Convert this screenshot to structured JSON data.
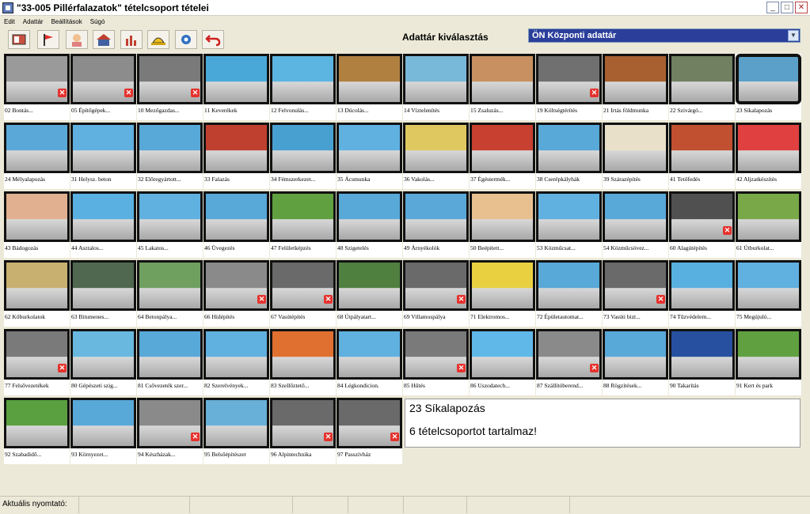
{
  "window": {
    "title": "\"33-005 Pillérfalazatok\" tételcsoport tételei",
    "min": "_",
    "max": "□",
    "close": "✕"
  },
  "menu": [
    "Edit",
    "Adattár",
    "Beállítások",
    "Súgó"
  ],
  "toolbar": {
    "buttons": [
      "book-icon",
      "flag-icon",
      "avatar-icon",
      "building-icon",
      "chart-icon",
      "helmet-icon",
      "gear-icon",
      "undo-arrow-icon"
    ]
  },
  "header": {
    "title": "Adattár kiválasztás",
    "selector_value": "ÖN Központi adattár",
    "arrow": "▼"
  },
  "tiles": [
    {
      "label": "02 Bontás...",
      "color": "#9a9a9a",
      "x": true
    },
    {
      "label": "05 Építőgépek...",
      "color": "#8c8c8c",
      "x": true
    },
    {
      "label": "10 Mezőgazdas...",
      "color": "#7a7a7a",
      "x": true
    },
    {
      "label": "11 Keverékek",
      "color": "#4aa8d8",
      "x": false
    },
    {
      "label": "12 Felvonulás...",
      "color": "#5cb4e0",
      "x": false
    },
    {
      "label": "13 Dúcolás...",
      "color": "#b08040",
      "x": false
    },
    {
      "label": "14 Víztelenítés",
      "color": "#78b8d8",
      "x": false
    },
    {
      "label": "15 Zsaluzás...",
      "color": "#c89060",
      "x": false
    },
    {
      "label": "19 Költségtérítés",
      "color": "#707070",
      "x": true
    },
    {
      "label": "21 Irtás földmunka",
      "color": "#a86030",
      "x": false
    },
    {
      "label": "22 Szivárgó...",
      "color": "#708060",
      "x": false
    },
    {
      "label": "23 Síkalapozás",
      "color": "#5aa0c8",
      "x": false
    },
    {
      "label": "24 Mélyalapozás",
      "color": "#5aa8d8",
      "x": false
    },
    {
      "label": "31 Helysz. beton",
      "color": "#60b0e0",
      "x": false
    },
    {
      "label": "32 Előregyártott...",
      "color": "#58a8d8",
      "x": false
    },
    {
      "label": "33 Falazás",
      "color": "#c04030",
      "x": false
    },
    {
      "label": "34 Fémszerkezet...",
      "color": "#48a0d0",
      "x": false
    },
    {
      "label": "35 Ácsmunka",
      "color": "#60b0e0",
      "x": false
    },
    {
      "label": "36 Vakolás...",
      "color": "#e0c860",
      "x": false
    },
    {
      "label": "37 Égéstermék...",
      "color": "#c84030",
      "x": false
    },
    {
      "label": "38 Cserépkályhák",
      "color": "#58a8d8",
      "x": false
    },
    {
      "label": "39 Szárazépítés",
      "color": "#e8e0c8",
      "x": false
    },
    {
      "label": "41 Tetőfedés",
      "color": "#c05030",
      "x": false
    },
    {
      "label": "42 Aljzatkészítés",
      "color": "#e04040",
      "x": false
    },
    {
      "label": "43 Bádogozás",
      "color": "#e0b090",
      "x": false
    },
    {
      "label": "44 Asztalos...",
      "color": "#5ab0e0",
      "x": false
    },
    {
      "label": "45 Lakatos...",
      "color": "#60b0e0",
      "x": false
    },
    {
      "label": "46 Üvegezés",
      "color": "#58a8d8",
      "x": false
    },
    {
      "label": "47 Felületképzés",
      "color": "#60a040",
      "x": false
    },
    {
      "label": "48 Szigetelés",
      "color": "#58a8d8",
      "x": false
    },
    {
      "label": "49 Árnyékolók",
      "color": "#5aa8d8",
      "x": false
    },
    {
      "label": "50 Beépített...",
      "color": "#e8c090",
      "x": false
    },
    {
      "label": "53 Közműcsat...",
      "color": "#60b0e0",
      "x": false
    },
    {
      "label": "54 Közműcsövez...",
      "color": "#58a8d8",
      "x": false
    },
    {
      "label": "60 Alagútépítés",
      "color": "#505050",
      "x": true
    },
    {
      "label": "61 Útburkolat...",
      "color": "#78a848",
      "x": false
    },
    {
      "label": "62 Kőburkolatok",
      "color": "#c8b070",
      "x": false
    },
    {
      "label": "63 Bitumenes...",
      "color": "#506850",
      "x": false
    },
    {
      "label": "64 Betonpálya...",
      "color": "#70a060",
      "x": false
    },
    {
      "label": "66 Hídépítés",
      "color": "#8a8a8a",
      "x": true
    },
    {
      "label": "67 Vasútépítés",
      "color": "#6a6a6a",
      "x": true
    },
    {
      "label": "68 Útpályatart...",
      "color": "#508040",
      "x": false
    },
    {
      "label": "69 Villamospálya",
      "color": "#6a6a6a",
      "x": true
    },
    {
      "label": "71 Elektromos...",
      "color": "#e8d040",
      "x": false
    },
    {
      "label": "72 Épületautomat...",
      "color": "#58a8d8",
      "x": false
    },
    {
      "label": "73 Vasúti bizt...",
      "color": "#6a6a6a",
      "x": true
    },
    {
      "label": "74 Tűzvédelem...",
      "color": "#58b0e0",
      "x": false
    },
    {
      "label": "75 Megújuló...",
      "color": "#60b0e0",
      "x": false
    },
    {
      "label": "77 Felsővezetékek",
      "color": "#7a7a7a",
      "x": true
    },
    {
      "label": "80 Gépészeti szig...",
      "color": "#68b8e0",
      "x": false
    },
    {
      "label": "81 Csővezeték szer...",
      "color": "#58a8d8",
      "x": false
    },
    {
      "label": "82 Szerelvények...",
      "color": "#60b0e0",
      "x": false
    },
    {
      "label": "83 Szellőztető...",
      "color": "#e07030",
      "x": false
    },
    {
      "label": "84 Légkondicion.",
      "color": "#60b0e0",
      "x": false
    },
    {
      "label": "85 Hűtés",
      "color": "#7a7a7a",
      "x": true
    },
    {
      "label": "86 Uszodatech...",
      "color": "#60b8e8",
      "x": false
    },
    {
      "label": "87 Szállítóberend...",
      "color": "#8a8a8a",
      "x": true
    },
    {
      "label": "88 Rögzítések...",
      "color": "#58a8d8",
      "x": false
    },
    {
      "label": "90 Takarítás",
      "color": "#2850a0",
      "x": false
    },
    {
      "label": "91 Kert és park",
      "color": "#60a040",
      "x": false
    },
    {
      "label": "92 Szabadidő...",
      "color": "#5aa040",
      "x": false
    },
    {
      "label": "93 Környezet...",
      "color": "#58a8d8",
      "x": false
    },
    {
      "label": "94 Készházak...",
      "color": "#8a8a8a",
      "x": true
    },
    {
      "label": "95 Belsőépítészet",
      "color": "#68b0d8",
      "x": false
    },
    {
      "label": "96 Alpintechnika",
      "color": "#6a6a6a",
      "x": true
    },
    {
      "label": "97 Passzívház",
      "color": "#6a6a6a",
      "x": true
    }
  ],
  "selected_index": 11,
  "info": {
    "line1": "23 Síkalapozás",
    "line2": "6 tételcsoportot tartalmaz!"
  },
  "status": {
    "printer_label": "Aktuális nyomtató:"
  }
}
